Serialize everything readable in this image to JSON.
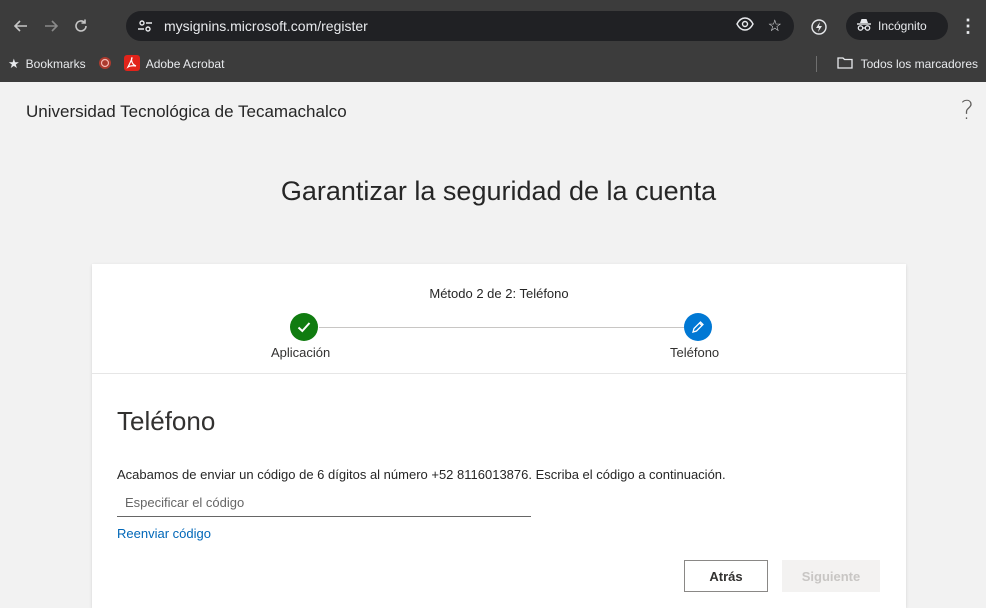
{
  "browser": {
    "url": "mysignins.microsoft.com/register",
    "incognito_label": "Incógnito",
    "bookmarks": {
      "bookmarks_label": "Bookmarks",
      "acrobat_label": "Adobe Acrobat",
      "all_bookmarks_label": "Todos los marcadores"
    }
  },
  "header": {
    "org_name": "Universidad Tecnológica de Tecamachalco",
    "help_glyph": "?"
  },
  "page": {
    "title": "Garantizar la seguridad de la cuenta"
  },
  "wizard": {
    "step_title": "Método 2 de 2: Teléfono",
    "steps": [
      {
        "label": "Aplicación",
        "status": "done"
      },
      {
        "label": "Teléfono",
        "status": "current"
      }
    ]
  },
  "phone": {
    "title": "Teléfono",
    "instructions": "Acabamos de enviar un código de 6 dígitos al número +52 8116013876. Escriba el código a continuación.",
    "code_placeholder": "Especificar el código",
    "code_value": "",
    "resend_label": "Reenviar código",
    "back_label": "Atrás",
    "next_label": "Siguiente"
  },
  "colors": {
    "chrome_bg": "#3c3c3c",
    "omnibox_bg": "#202124",
    "success_green": "#107c10",
    "accent_blue": "#0078d4",
    "link_blue": "#0067b8"
  }
}
